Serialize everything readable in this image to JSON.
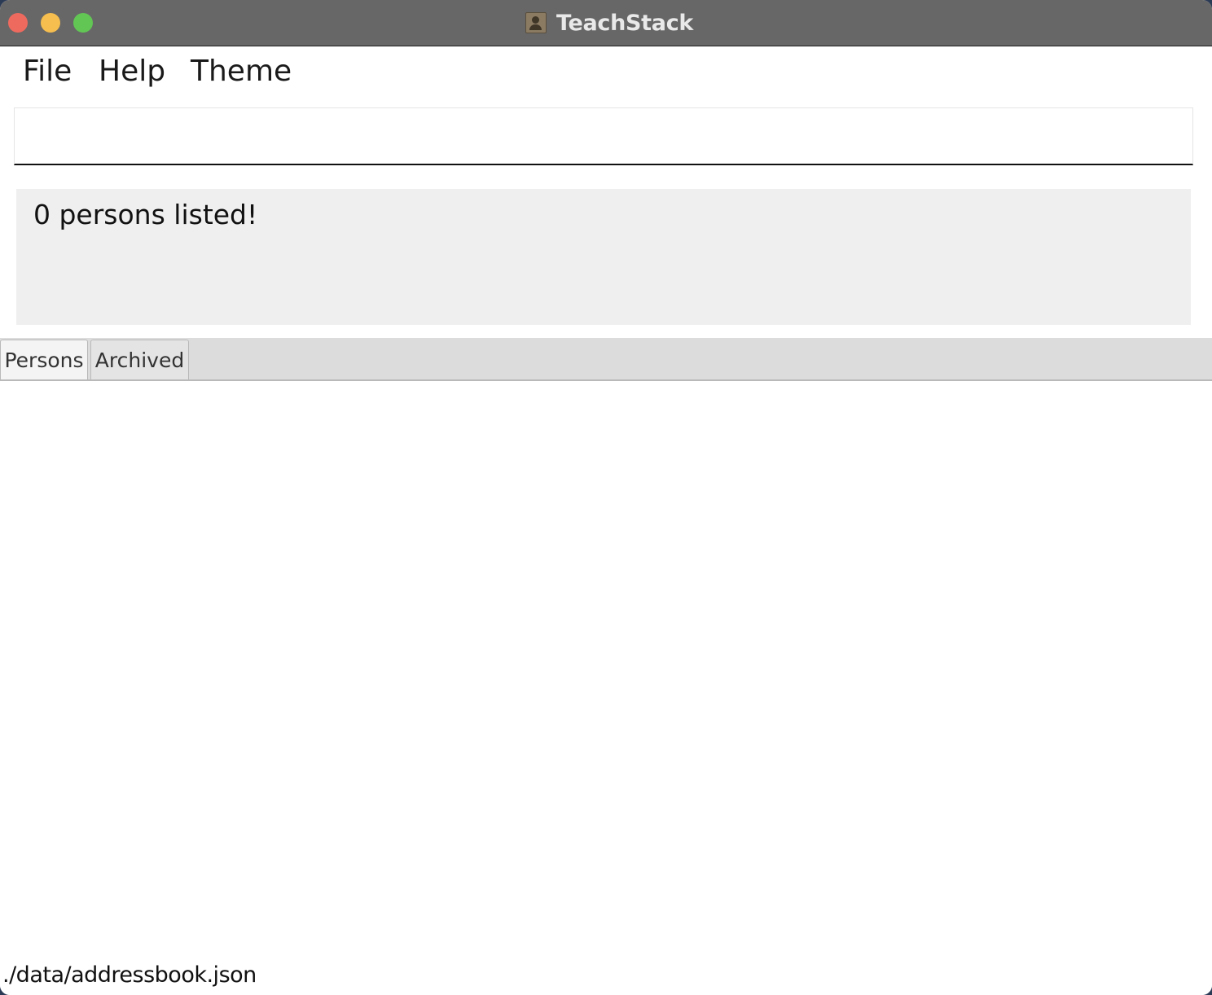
{
  "window": {
    "title": "TeachStack",
    "app_icon": "contact-book-icon"
  },
  "menu": {
    "items": [
      {
        "label": "File"
      },
      {
        "label": "Help"
      },
      {
        "label": "Theme"
      }
    ]
  },
  "command": {
    "value": "",
    "placeholder": ""
  },
  "result": {
    "message": "0 persons listed!"
  },
  "tabs": [
    {
      "label": "Persons",
      "selected": true
    },
    {
      "label": "Archived",
      "selected": false
    }
  ],
  "status": {
    "file_path": "./data/addressbook.json"
  },
  "colors": {
    "titlebar": "#676767",
    "close": "#ee6a5e",
    "minimize": "#f5be4f",
    "maximize": "#62c655",
    "result_bg": "#efefef",
    "tabbar_bg": "#dcdcdc"
  }
}
